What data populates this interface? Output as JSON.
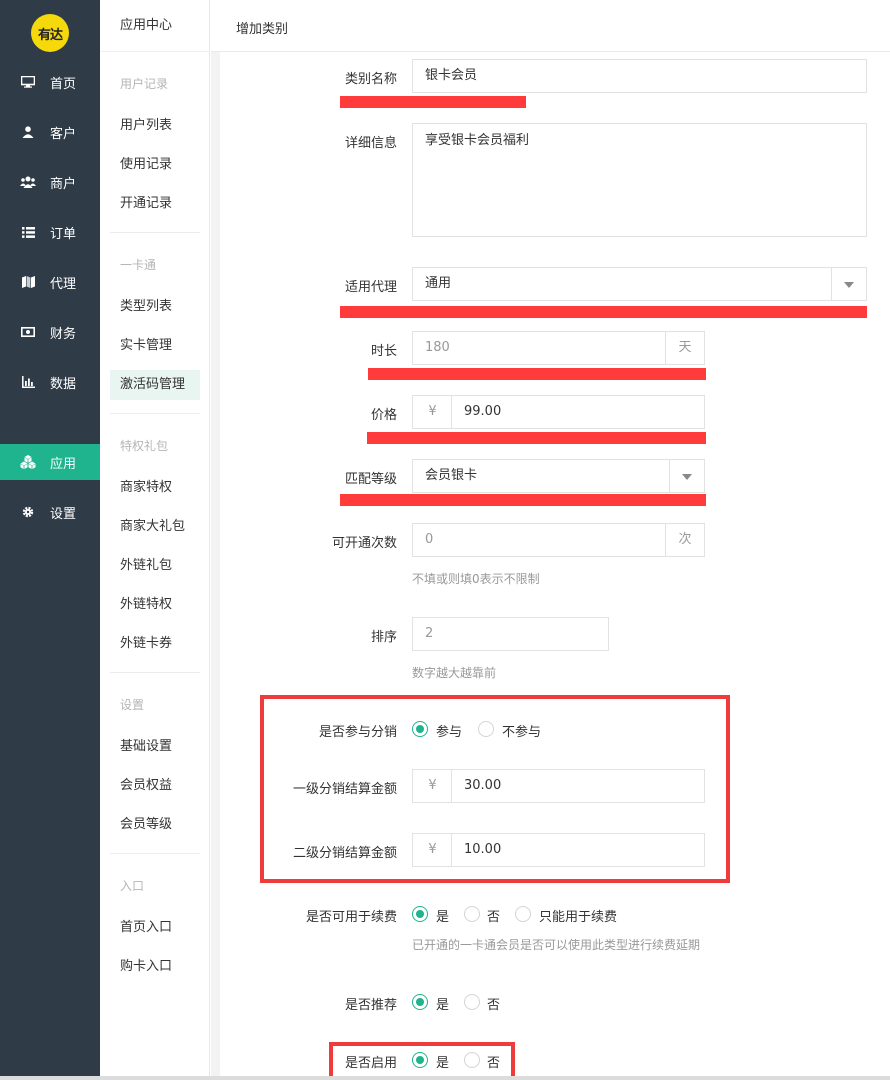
{
  "logo": {
    "text": "有达"
  },
  "nav": [
    {
      "label": "首页",
      "icon": "monitor-icon"
    },
    {
      "label": "客户",
      "icon": "user-icon"
    },
    {
      "label": "商户",
      "icon": "users-icon"
    },
    {
      "label": "订单",
      "icon": "list-icon"
    },
    {
      "label": "代理",
      "icon": "map-icon"
    },
    {
      "label": "财务",
      "icon": "money-icon"
    },
    {
      "label": "数据",
      "icon": "bar-chart-icon"
    },
    {
      "label": "应用",
      "icon": "cubes-icon"
    },
    {
      "label": "设置",
      "icon": "gear-icon"
    }
  ],
  "submenu": {
    "title": "应用中心",
    "groups": [
      {
        "name": "用户记录",
        "items": [
          "用户列表",
          "使用记录",
          "开通记录"
        ]
      },
      {
        "name": "一卡通",
        "items": [
          "类型列表",
          "实卡管理",
          "激活码管理"
        ]
      },
      {
        "name": "特权礼包",
        "items": [
          "商家特权",
          "商家大礼包",
          "外链礼包",
          "外链特权",
          "外链卡券"
        ]
      },
      {
        "name": "设置",
        "items": [
          "基础设置",
          "会员权益",
          "会员等级"
        ]
      },
      {
        "name": "入口",
        "items": [
          "首页入口",
          "购卡入口"
        ]
      }
    ]
  },
  "page": {
    "title": "增加类别"
  },
  "form": {
    "category_name": {
      "label": "类别名称",
      "value": "银卡会员"
    },
    "detail": {
      "label": "详细信息",
      "value": "享受银卡会员福利"
    },
    "agent": {
      "label": "适用代理",
      "value": "通用"
    },
    "duration": {
      "label": "时长",
      "value": "180",
      "unit": "天"
    },
    "price": {
      "label": "价格",
      "prefix": "¥",
      "value": "99.00"
    },
    "level": {
      "label": "匹配等级",
      "value": "会员银卡"
    },
    "open_times": {
      "label": "可开通次数",
      "value": "0",
      "unit": "次",
      "help": "不填或则填0表示不限制"
    },
    "sort": {
      "label": "排序",
      "value": "2",
      "help": "数字越大越靠前"
    },
    "distribution": {
      "label": "是否参与分销",
      "options": [
        "参与",
        "不参与"
      ],
      "selected": 0
    },
    "level1": {
      "label": "一级分销结算金额",
      "prefix": "¥",
      "value": "30.00"
    },
    "level2": {
      "label": "二级分销结算金额",
      "prefix": "¥",
      "value": "10.00"
    },
    "renew": {
      "label": "是否可用于续费",
      "options": [
        "是",
        "否",
        "只能用于续费"
      ],
      "selected": 0,
      "help": "已开通的一卡通会员是否可以使用此类型进行续费延期"
    },
    "recommend": {
      "label": "是否推荐",
      "options": [
        "是",
        "否"
      ],
      "selected": 0
    },
    "enable": {
      "label": "是否启用",
      "options": [
        "是",
        "否"
      ],
      "selected": 0
    }
  }
}
